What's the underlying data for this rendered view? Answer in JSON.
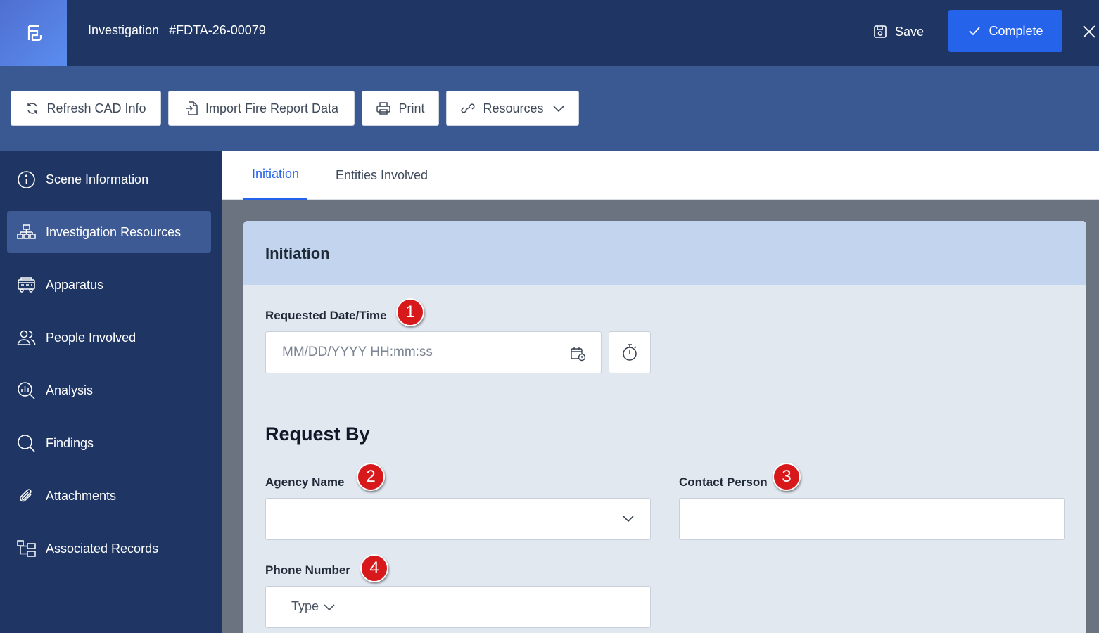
{
  "header": {
    "title": "Investigation",
    "case_number": "#FDTA-26-00079",
    "save_label": "Save",
    "complete_label": "Complete",
    "logo_icon": "form-logo-icon",
    "close_icon": "close-icon"
  },
  "toolbar": {
    "refresh_label": "Refresh CAD Info",
    "import_label": "Import Fire Report Data",
    "print_label": "Print",
    "resources_label": "Resources"
  },
  "sidebar": {
    "items": [
      {
        "label": "Scene Information",
        "icon": "info-icon"
      },
      {
        "label": "Investigation Resources",
        "icon": "org-chart-icon",
        "active": true
      },
      {
        "label": "Apparatus",
        "icon": "fire-truck-icon"
      },
      {
        "label": "People Involved",
        "icon": "people-icon"
      },
      {
        "label": "Analysis",
        "icon": "analysis-icon"
      },
      {
        "label": "Findings",
        "icon": "search-icon"
      },
      {
        "label": "Attachments",
        "icon": "paperclip-icon"
      },
      {
        "label": "Associated Records",
        "icon": "hierarchy-icon"
      }
    ]
  },
  "tabs": [
    {
      "label": "Initiation",
      "active": true
    },
    {
      "label": "Entities Involved",
      "active": false
    }
  ],
  "form": {
    "card_title": "Initiation",
    "requested_label": "Requested Date/Time",
    "requested_placeholder": "MM/DD/YYYY HH:mm:ss",
    "section_title": "Request By",
    "agency_label": "Agency Name",
    "agency_value": "",
    "contact_label": "Contact Person",
    "contact_value": "",
    "phone_label": "Phone Number",
    "phone_type": "Type"
  },
  "badges": [
    "1",
    "2",
    "3",
    "4"
  ],
  "colors": {
    "header_bg": "#1f3665",
    "toolbar_bg": "#3a5892",
    "accent": "#2563eb",
    "card_header": "#c3d4ee",
    "badge": "#d7191c"
  }
}
